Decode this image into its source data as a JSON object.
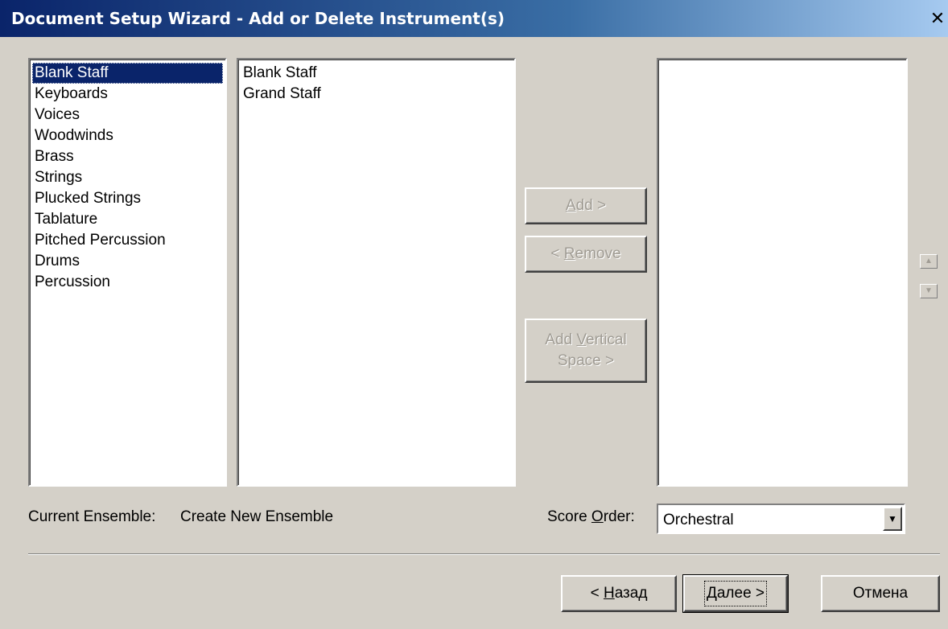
{
  "window": {
    "title": "Document Setup Wizard - Add or Delete Instrument(s)",
    "close_glyph": "✕"
  },
  "categories": [
    "Blank Staff",
    "Keyboards",
    "Voices",
    "Woodwinds",
    "Brass",
    "Strings",
    "Plucked Strings",
    "Tablature",
    "Pitched Percussion",
    "Drums",
    "Percussion"
  ],
  "selected_category_index": 0,
  "instruments": [
    "Blank Staff",
    "Grand Staff"
  ],
  "score_instruments": [],
  "buttons": {
    "add": {
      "pre": "",
      "mn": "A",
      "post": "dd >"
    },
    "remove": {
      "pre": "< ",
      "mn": "R",
      "post": "emove"
    },
    "add_vertical": {
      "line1_pre": "Add ",
      "mn": "V",
      "line1_post": "ertical",
      "line2": "Space >"
    },
    "back": {
      "pre": "< ",
      "mn": "Н",
      "post": "азад"
    },
    "next": {
      "pre": "",
      "mn": "Д",
      "post": "алее >"
    },
    "cancel": "Отмена"
  },
  "current_ensemble": {
    "label": "Current Ensemble:",
    "value": "Create New Ensemble"
  },
  "score_order": {
    "label_pre": "Score ",
    "mn": "O",
    "label_post": "rder:",
    "value": "Orchestral"
  },
  "icons": {
    "move_up": "up-arrow-icon",
    "move_down": "down-arrow-icon",
    "dropdown": "chevron-down-icon"
  }
}
